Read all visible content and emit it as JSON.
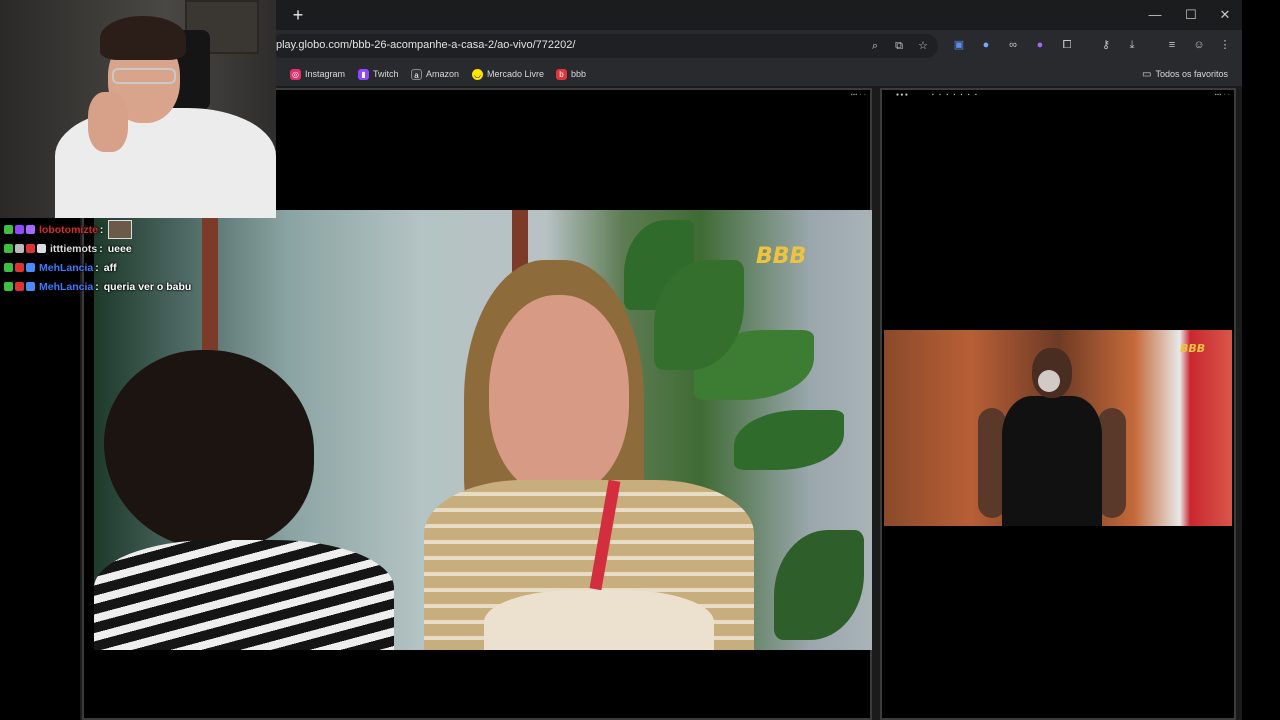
{
  "browser": {
    "new_tab_symbol": "+",
    "window_controls": {
      "minimize": "—",
      "maximize": "☐",
      "close": "✕"
    },
    "address_bar": {
      "url": "play.globo.com/bbb-26-acompanhe-a-casa-2/ao-vivo/772202/"
    },
    "bookmarks": [
      {
        "label": "Instagram",
        "icon": "instagram-icon",
        "color": "#e1306c"
      },
      {
        "label": "Twitch",
        "icon": "twitch-icon",
        "color": "#9146ff"
      },
      {
        "label": "Amazon",
        "icon": "amazon-icon",
        "color": "#333333"
      },
      {
        "label": "Mercado Livre",
        "icon": "mercado-livre-icon",
        "color": "#ffe600"
      },
      {
        "label": "bbb",
        "icon": "bbb-icon",
        "color": "#e2343c"
      }
    ],
    "all_bookmarks_label": "Todos os favoritos"
  },
  "streams": {
    "main_logo": "BBB",
    "side_logo": "BBB"
  },
  "chat": {
    "messages": [
      {
        "user": "lobotomizte",
        "message": "",
        "user_color": "#d62b2b",
        "has_emote": true
      },
      {
        "user": "itttiemots",
        "message": "ueee",
        "user_color": "#dcdcdc",
        "has_emote": false
      },
      {
        "user": "MehLancia",
        "message": "aff",
        "user_color": "#3a7bff",
        "has_emote": false
      },
      {
        "user": "MehLancia",
        "message": "queria ver o babu",
        "user_color": "#3a7bff",
        "has_emote": false
      }
    ]
  }
}
